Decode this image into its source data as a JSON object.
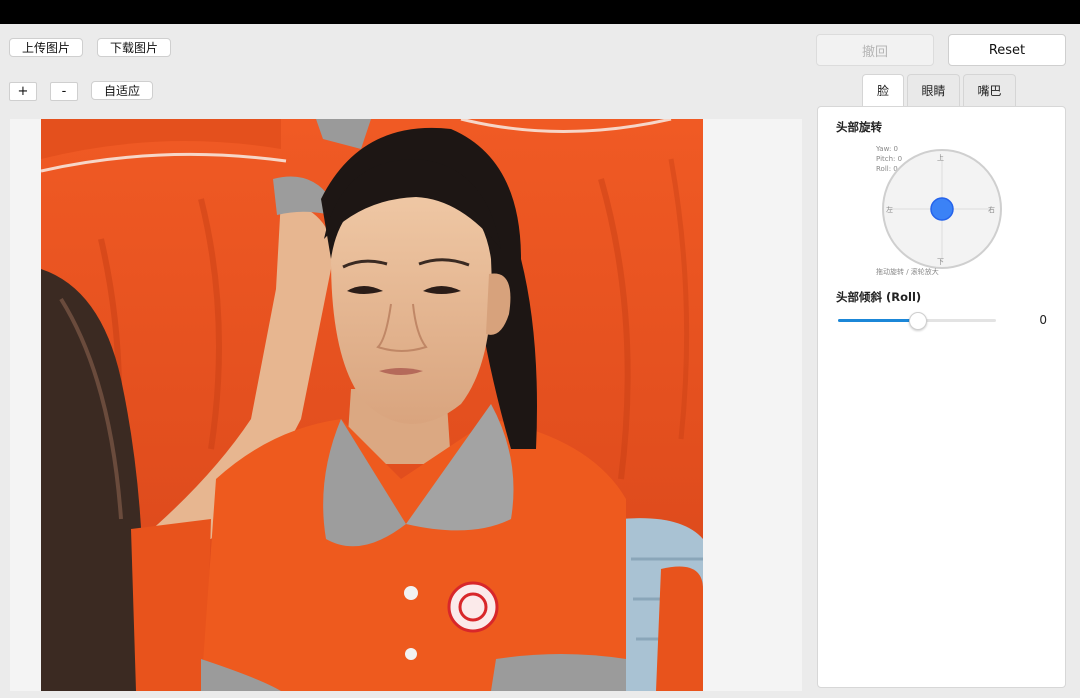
{
  "toolbar": {
    "upload_label": "上传图片",
    "download_label": "下载图片",
    "zoom_in_label": "+",
    "zoom_out_label": "-",
    "fit_label": "自适应",
    "undo_label": "撤回",
    "reset_label": "Reset"
  },
  "tabs": [
    {
      "label": "脸",
      "active": true
    },
    {
      "label": "眼睛",
      "active": false
    },
    {
      "label": "嘴巴",
      "active": false
    }
  ],
  "panel": {
    "head_rotation_title": "头部旋转",
    "readout": {
      "yaw": "Yaw: 0",
      "pitch": "Pitch: 0",
      "roll": "Roll: 0"
    },
    "joystick": {
      "up": "上",
      "down": "下",
      "left": "左",
      "right": "右"
    },
    "joystick_hint": "拖动旋转 / 滚轮放大",
    "tilt_title": "头部倾斜 (Roll)",
    "tilt_value": "0",
    "tilt_fraction": 0.5
  },
  "colors": {
    "accent": "#1b87d8",
    "joystick_dot": "#3b82f6",
    "shirt_orange": "#e8531c"
  },
  "photo": {
    "description_icon": "portrait-photo"
  }
}
